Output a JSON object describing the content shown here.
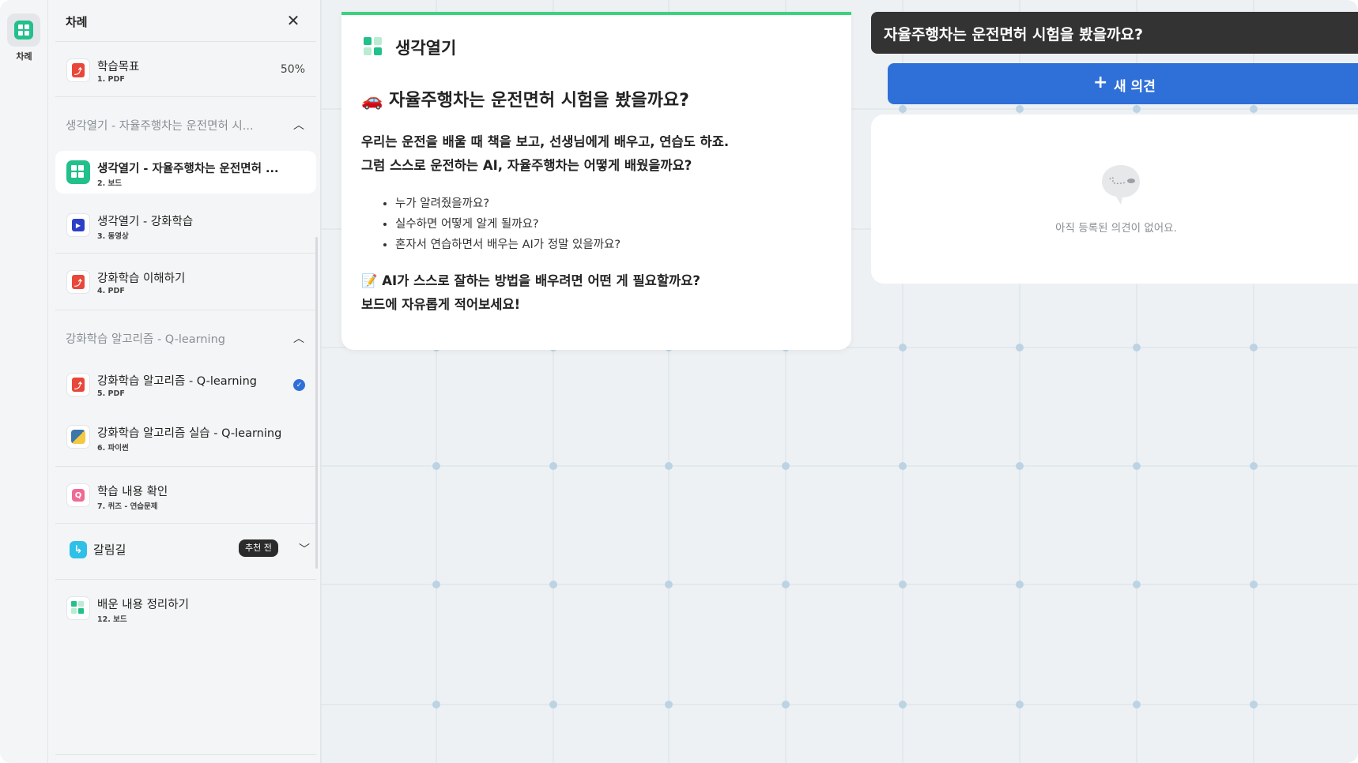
{
  "rail": {
    "label": "차례",
    "icon": "board-icon"
  },
  "sidebar": {
    "title": "차례",
    "items": [
      {
        "title": "학습목표",
        "sub": "1. PDF",
        "progress": "50%",
        "icon": "pdf-icon"
      },
      {
        "title": "생각열기 - 자율주행차는 운전면허 ...",
        "sub": "2. 보드",
        "icon": "board-icon",
        "active": true
      },
      {
        "title": "생각열기 - 강화학습",
        "sub": "3. 동영상",
        "icon": "video-icon"
      },
      {
        "title": "강화학습 이해하기",
        "sub": "4. PDF",
        "icon": "pdf-icon"
      },
      {
        "title": "강화학습 알고리즘 - Q-learning",
        "sub": "5. PDF",
        "icon": "pdf-icon",
        "completed": true
      },
      {
        "title": "강화학습 알고리즘 실습 - Q-learning",
        "sub": "6. 파이썬",
        "icon": "python-icon"
      },
      {
        "title": "학습 내용 확인",
        "sub": "7. 퀴즈 - 연습문제",
        "icon": "quiz-icon"
      },
      {
        "title": "배운 내용 정리하기",
        "sub": "12. 보드",
        "icon": "board-icon"
      }
    ],
    "sections": [
      {
        "label": "생각열기 - 자율주행차는 운전면허 시..."
      },
      {
        "label": "강화학습 알고리즘 - Q-learning"
      }
    ],
    "branch": {
      "label": "갈림길",
      "badge": "추천 전"
    }
  },
  "card": {
    "title": "생각열기",
    "question": "🚗 자율주행차는 운전면허 시험을 봤을까요?",
    "para1": "우리는 운전을 배울 때 책을 보고, 선생님에게 배우고, 연습도 하죠.",
    "para2": "그럼 스스로 운전하는 AI, 자율주행차는 어떻게 배웠을까요?",
    "bullets": [
      "누가 알려줬을까요?",
      "실수하면 어떻게 알게 될까요?",
      "혼자서 연습하면서 배우는 AI가 정말 있을까요?"
    ],
    "final1": "📝 AI가 스스로 잘하는 방법을 배우려면 어떤 게 필요할까요?",
    "final2": "보드에 자유롭게 적어보세요!"
  },
  "panel": {
    "heading": "자율주행차는 운전면허 시험을 봤을까요?",
    "new_button": "새 의견",
    "empty_text": "아직 등록된 의견이 없어요."
  },
  "colors": {
    "accent_green": "#22c08a",
    "primary_blue": "#2f6fd8",
    "header_dark": "#333333",
    "grid_line": "#d5e1ea",
    "grid_dot": "#bcd3e4"
  }
}
